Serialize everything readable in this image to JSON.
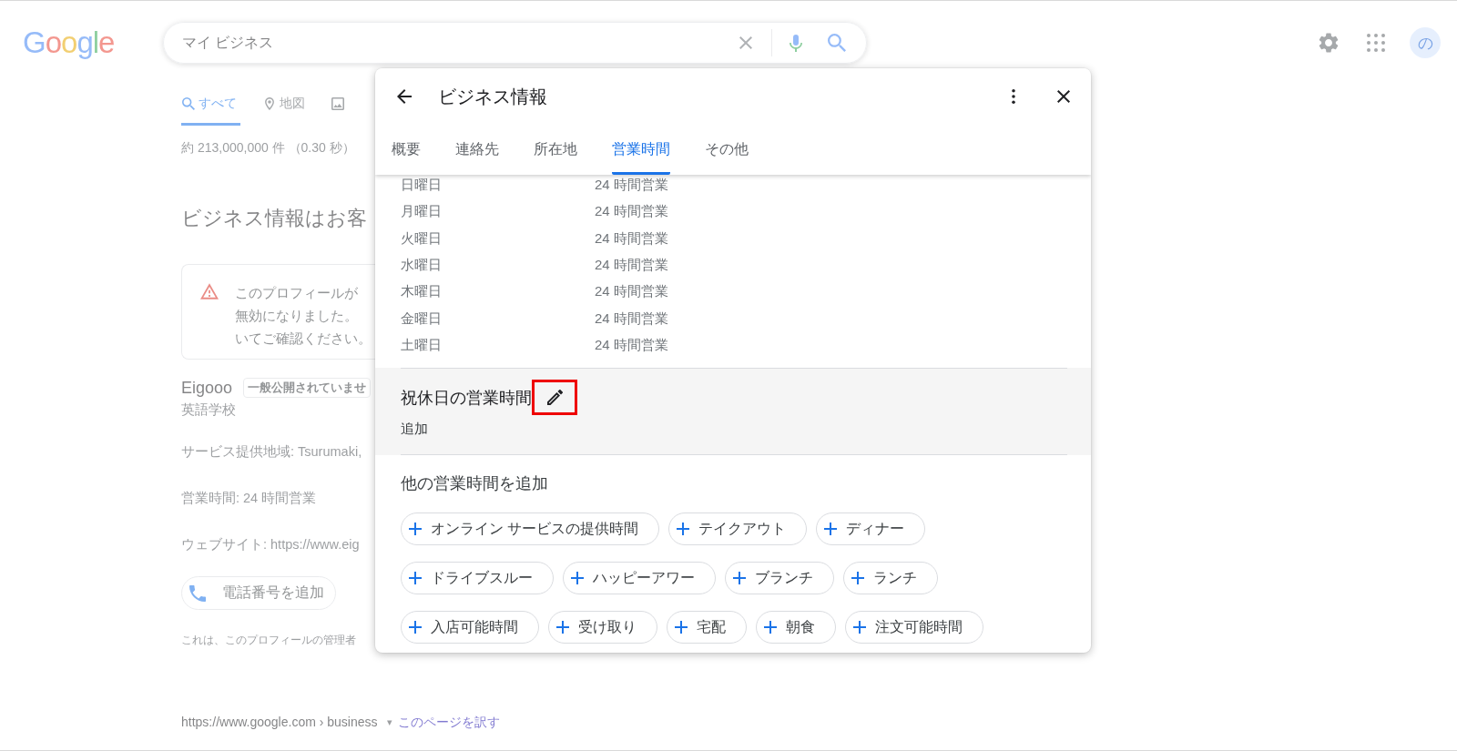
{
  "page": {
    "logo": "Google",
    "search": {
      "value": "マイ ビジネス"
    },
    "avatar": "の",
    "nav_tabs": [
      {
        "kind": "search",
        "label": "すべて",
        "selected": true
      },
      {
        "kind": "map",
        "label": "地図",
        "selected": false
      },
      {
        "kind": "image",
        "selected": false
      }
    ],
    "result_stats": "約 213,000,000 件 （0.30 秒）",
    "heading": "ビジネス情報はお客",
    "notice": {
      "lines": [
        "このプロフィールが",
        "無効になりました。",
        "いてご確認ください。"
      ]
    },
    "business": {
      "name": "Eigooo",
      "badge": "一般公開されていませ",
      "category": "英語学校"
    },
    "details": [
      "サービス提供地域: Tsurumaki,",
      "営業時間: 24 時間営業",
      "ウェブサイト: https://www.eig"
    ],
    "phone_button": "電話番号を追加",
    "footnote": "これは、このプロフィールの管理者",
    "result": {
      "url": "https://www.google.com › business",
      "caret": "▾",
      "translate_link": "このページを訳す"
    }
  },
  "dialog": {
    "title": "ビジネス情報",
    "tabs": [
      {
        "label": "概要",
        "selected": false
      },
      {
        "label": "連絡先",
        "selected": false
      },
      {
        "label": "所在地",
        "selected": false
      },
      {
        "label": "営業時間",
        "selected": true
      },
      {
        "label": "その他",
        "selected": false
      }
    ],
    "hours": [
      {
        "day": "日曜日",
        "hours": "24 時間営業"
      },
      {
        "day": "月曜日",
        "hours": "24 時間営業"
      },
      {
        "day": "火曜日",
        "hours": "24 時間営業"
      },
      {
        "day": "水曜日",
        "hours": "24 時間営業"
      },
      {
        "day": "木曜日",
        "hours": "24 時間営業"
      },
      {
        "day": "金曜日",
        "hours": "24 時間営業"
      },
      {
        "day": "土曜日",
        "hours": "24 時間営業"
      }
    ],
    "holiday": {
      "title": "祝休日の営業時間",
      "action": "追加",
      "edit_highlighted": true
    },
    "more_title": "他の営業時間を追加",
    "chips": [
      "オンライン サービスの提供時間",
      "テイクアウト",
      "ディナー",
      "ドライブスルー",
      "ハッピーアワー",
      "ブランチ",
      "ランチ",
      "入店可能時間",
      "受け取り",
      "宅配",
      "朝食",
      "注文可能時間"
    ]
  }
}
